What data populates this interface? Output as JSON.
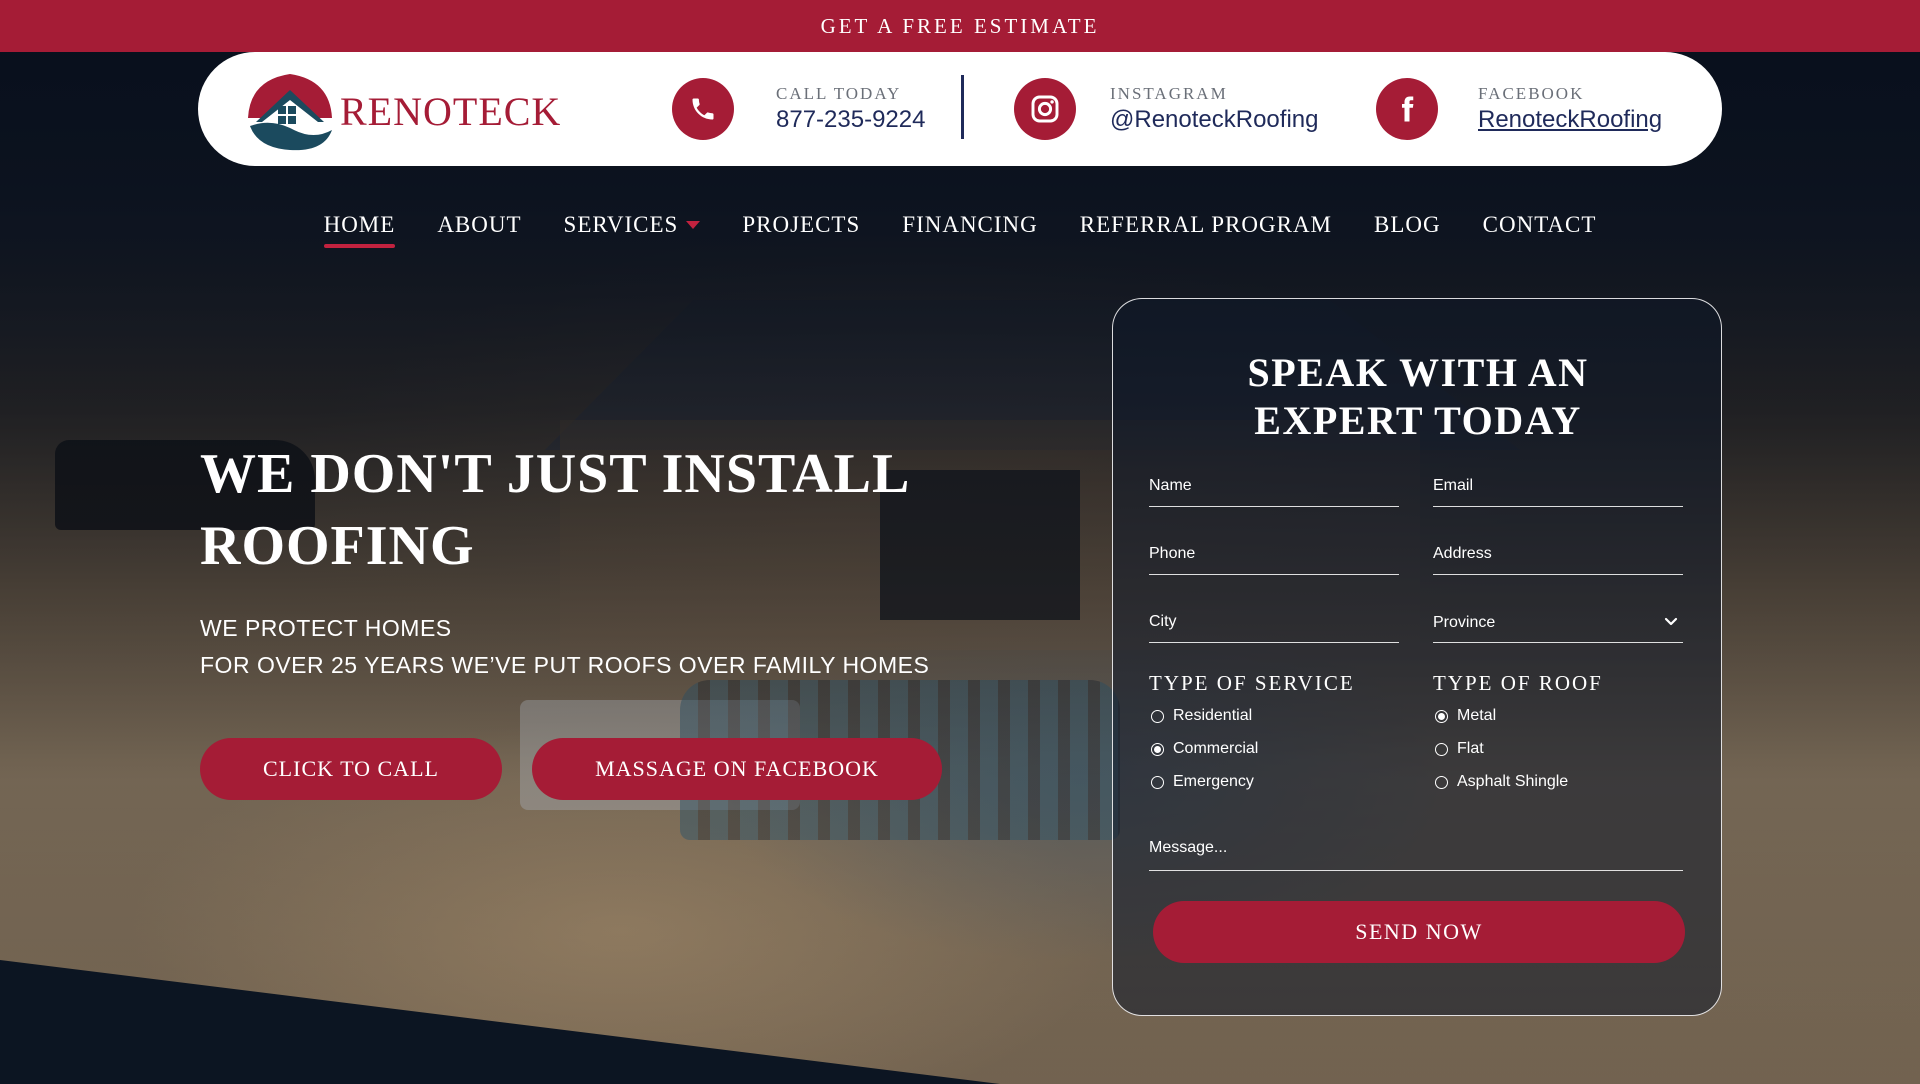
{
  "topbar": {
    "cta": "GET A FREE ESTIMATE"
  },
  "brand": {
    "name": "RENOTECK"
  },
  "contacts": {
    "phone": {
      "caption": "CALL TODAY",
      "value": "877-235-9224"
    },
    "instagram": {
      "caption": "INSTAGRAM",
      "value": "@RenoteckRoofing"
    },
    "facebook": {
      "caption": "FACEBOOK",
      "value": "RenoteckRoofing"
    }
  },
  "nav": {
    "items": [
      {
        "label": "HOME",
        "active": true
      },
      {
        "label": "ABOUT"
      },
      {
        "label": "SERVICES",
        "has_dropdown": true
      },
      {
        "label": "PROJECTS"
      },
      {
        "label": "FINANCING"
      },
      {
        "label": "REFERRAL PROGRAM"
      },
      {
        "label": "BLOG"
      },
      {
        "label": "CONTACT"
      }
    ]
  },
  "hero": {
    "title_line1": "WE DON'T JUST INSTALL",
    "title_line2": "ROOFING",
    "sub_line1": "WE PROTECT HOMES",
    "sub_line2": "FOR OVER 25 YEARS WE’VE PUT ROOFS OVER FAMILY HOMES",
    "call_button": "CLICK TO CALL",
    "facebook_button": "MASSAGE ON FACEBOOK"
  },
  "form": {
    "title_line1": "SPEAK WITH AN",
    "title_line2": "EXPERT TODAY",
    "fields": {
      "name": "Name",
      "email": "Email",
      "phone": "Phone",
      "address": "Address",
      "city": "City",
      "province": "Province"
    },
    "service": {
      "title": "TYPE OF SERVICE",
      "options": [
        "Residential",
        "Commercial",
        "Emergency"
      ],
      "selected": "Commercial"
    },
    "roof": {
      "title": "TYPE OF ROOF",
      "options": [
        "Metal",
        "Flat",
        "Asphalt Shingle"
      ],
      "selected": "Metal"
    },
    "message_placeholder": "Message...",
    "submit": "SEND NOW"
  },
  "colors": {
    "brand_red": "#a51c36",
    "navy": "#1f2a5a",
    "logo_teal": "#1b4a5e"
  },
  "icons": {
    "phone": "phone-icon",
    "instagram": "instagram-icon",
    "facebook": "facebook-icon",
    "services_caret": "caret-down-icon",
    "province_chevron": "chevron-down-icon"
  }
}
